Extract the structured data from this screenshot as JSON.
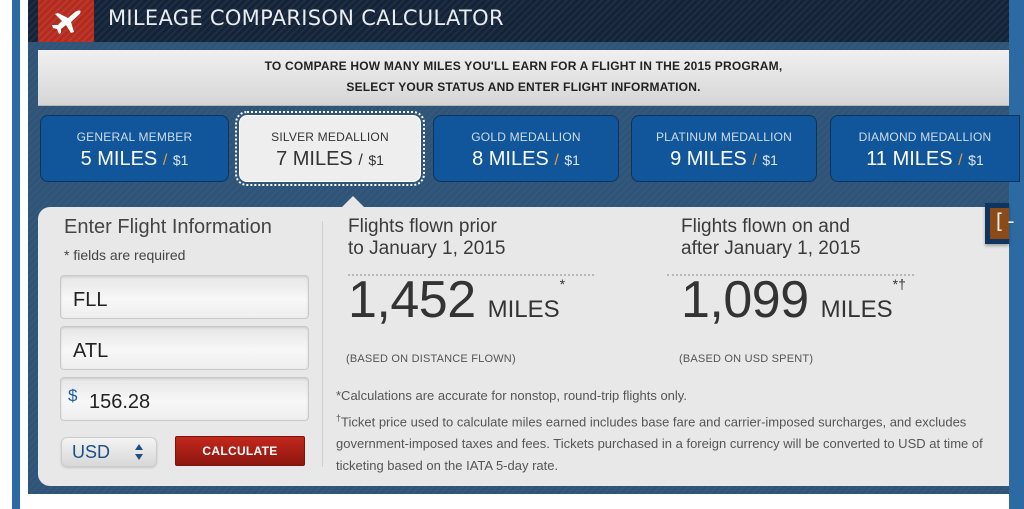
{
  "header": {
    "icon": "airplane-icon",
    "title": "MILEAGE COMPARISON CALCULATOR"
  },
  "intro": {
    "line1": "TO COMPARE HOW MANY MILES YOU'LL EARN FOR A FLIGHT IN THE 2015 PROGRAM,",
    "line2": "SELECT YOUR STATUS AND ENTER FLIGHT INFORMATION."
  },
  "tiers": [
    {
      "label": "GENERAL MEMBER",
      "miles": "5 MILES",
      "slash": "/",
      "unit": "$1",
      "selected": false
    },
    {
      "label": "SILVER MEDALLION",
      "miles": "7 MILES",
      "slash": "/",
      "unit": "$1",
      "selected": true
    },
    {
      "label": "GOLD MEDALLION",
      "miles": "8 MILES",
      "slash": "/",
      "unit": "$1",
      "selected": false
    },
    {
      "label": "PLATINUM MEDALLION",
      "miles": "9 MILES",
      "slash": "/",
      "unit": "$1",
      "selected": false
    },
    {
      "label": "DIAMOND MEDALLION",
      "miles": "11 MILES",
      "slash": "/",
      "unit": "$1",
      "selected": false
    }
  ],
  "form": {
    "title": "Enter Flight Information",
    "required_note": "* fields are required",
    "origin_value": "FLL",
    "destination_value": "ATL",
    "price_symbol": "$",
    "price_value": "156.28",
    "currency": "USD",
    "currency_icon": "up-down-arrows-icon",
    "calculate_label": "CALCULATE"
  },
  "results": {
    "prior": {
      "title_line1": "Flights flown prior",
      "title_line2": "to January 1, 2015",
      "value": "1,452",
      "unit": "MILES",
      "marker": "*",
      "basis": "(BASED ON DISTANCE FLOWN)"
    },
    "after": {
      "title_line1": "Flights flown on and",
      "title_line2": "after January 1, 2015",
      "value": "1,099",
      "unit": "MILES",
      "marker": "*†",
      "basis": "(BASED ON USD SPENT)"
    }
  },
  "notes": {
    "note1": "*Calculations are accurate for nonstop, round-trip flights only.",
    "note2_marker": "†",
    "note2": "Ticket price used to calculate miles earned includes base fare and carrier-imposed surcharges, and excludes government-imposed taxes and fees. Tickets purchased in a foreign currency will be converted to USD at time of ticketing based on the IATA 5-day rate."
  },
  "side_tab": {
    "glyph": "[-",
    "icon": "collapse-bracket-icon"
  },
  "colors": {
    "header_bg": "#142338",
    "accent_red": "#b52a1e",
    "tab_blue": "#11569a",
    "slash_orange": "#e79b3c",
    "frame_blue": "#2f5478",
    "rail_blue": "#2b6aa3"
  }
}
